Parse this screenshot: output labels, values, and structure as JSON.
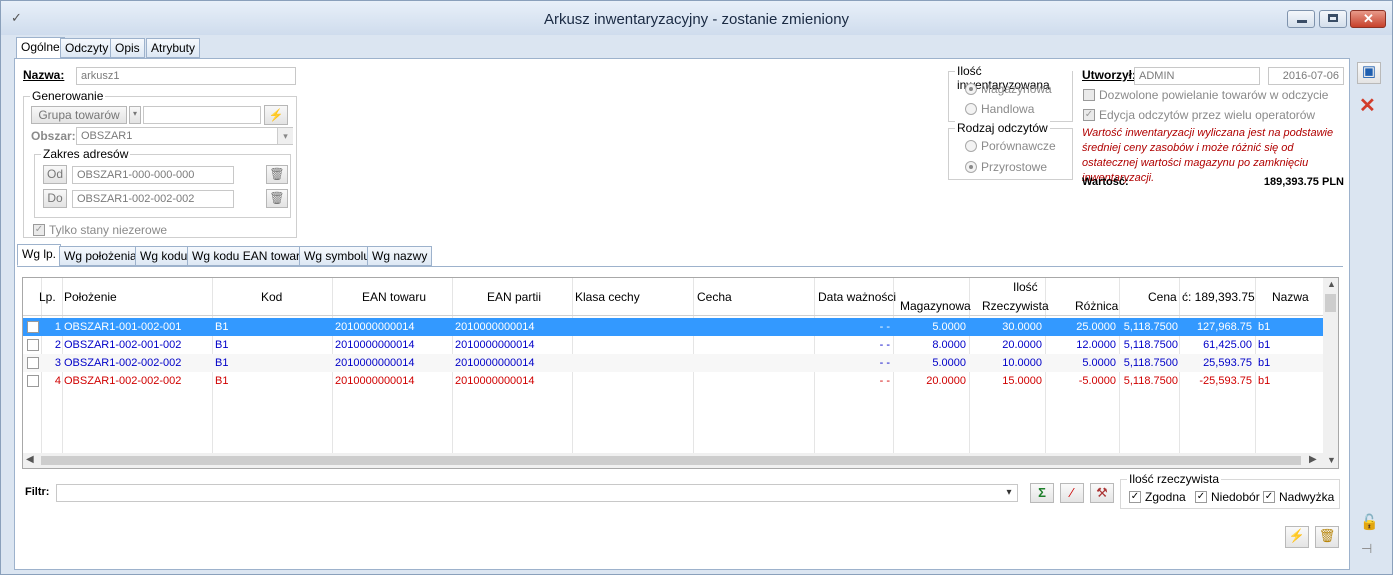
{
  "window": {
    "title": "Arkusz inwentaryzacyjny - zostanie zmieniony"
  },
  "tabs": [
    "Ogólne",
    "Odczyty",
    "Opis",
    "Atrybuty"
  ],
  "form": {
    "nazwa_label": "Nazwa:",
    "nazwa_value": "arkusz1",
    "generowanie_label": "Generowanie",
    "grupa_button": "Grupa towarów",
    "obszar_label": "Obszar:",
    "obszar_value": "OBSZAR1",
    "zakres_label": "Zakres adresów",
    "od_label": "Od",
    "od_value": "OBSZAR1-000-000-000",
    "do_label": "Do",
    "do_value": "OBSZAR1-002-002-002",
    "tylko_label": "Tylko stany niezerowe",
    "ilosc_group": "Ilość inwentaryzowana",
    "magazynowa": "Magazynowa",
    "handlowa": "Handlowa",
    "rodzaj_group": "Rodzaj odczytów",
    "porownawcze": "Porównawcze",
    "przyrostowe": "Przyrostowe",
    "utworzyl_label": "Utworzył:",
    "utworzyl_value": "ADMIN",
    "date_value": "2016-07-06",
    "dozwolone": "Dozwolone powielanie towarów w odczycie",
    "edycja": "Edycja odczytów przez wielu operatorów",
    "note": "Wartość inwentaryzacji wyliczana jest na podstawie średniej ceny zasobów i może różnić się od ostatecznej wartości magazynu po zamknięciu inwentaryzacji.",
    "wartosc_label": "Wartość:",
    "wartosc_value": "189,393.75 PLN"
  },
  "subtabs": [
    "Wg lp.",
    "Wg położenia",
    "Wg kodu",
    "Wg kodu EAN towaru",
    "Wg symbolu",
    "Wg nazwy"
  ],
  "grid": {
    "headers": {
      "lp": "Lp.",
      "polozenie": "Położenie",
      "kod": "Kod",
      "ean": "EAN towaru",
      "ean_partii": "EAN partii",
      "klasa": "Klasa cechy",
      "cecha": "Cecha",
      "data": "Data ważności",
      "ilosc": "Ilość",
      "magazynowa": "Magazynowa",
      "rzeczywista": "Rzeczywista",
      "roznica": "Różnica",
      "cena": "Cena",
      "wartosc": "ć: 189,393.75",
      "nazwa": "Nazwa"
    },
    "rows": [
      {
        "lp": "1",
        "polozenie": "OBSZAR1-001-002-001",
        "kod": "B1",
        "ean": "2010000000014",
        "ean_partii": "2010000000014",
        "data": "- -",
        "mag": "5.0000",
        "rzecz": "30.0000",
        "roz": "25.0000",
        "cena": "5,118.7500",
        "wart": "127,968.75",
        "nazwa": "b1"
      },
      {
        "lp": "2",
        "polozenie": "OBSZAR1-002-001-002",
        "kod": "B1",
        "ean": "2010000000014",
        "ean_partii": "2010000000014",
        "data": "- -",
        "mag": "8.0000",
        "rzecz": "20.0000",
        "roz": "12.0000",
        "cena": "5,118.7500",
        "wart": "61,425.00",
        "nazwa": "b1"
      },
      {
        "lp": "3",
        "polozenie": "OBSZAR1-002-002-002",
        "kod": "B1",
        "ean": "2010000000014",
        "ean_partii": "2010000000014",
        "data": "- -",
        "mag": "5.0000",
        "rzecz": "10.0000",
        "roz": "5.0000",
        "cena": "5,118.7500",
        "wart": "25,593.75",
        "nazwa": "b1"
      },
      {
        "lp": "4",
        "polozenie": "OBSZAR1-002-002-002",
        "kod": "B1",
        "ean": "2010000000014",
        "ean_partii": "2010000000014",
        "data": "- -",
        "mag": "20.0000",
        "rzecz": "15.0000",
        "roz": "-5.0000",
        "cena": "5,118.7500",
        "wart": "-25,593.75",
        "nazwa": "b1"
      }
    ]
  },
  "filter": {
    "label": "Filtr:",
    "value": ""
  },
  "ilosc_rzecz": {
    "label": "Ilość rzeczywista",
    "zgodna": "Zgodna",
    "niedobor": "Niedobór",
    "nadwyzka": "Nadwyżka"
  },
  "colors": {
    "selected": "#3399ff",
    "blue": "#0000c8",
    "red": "#d00000"
  }
}
